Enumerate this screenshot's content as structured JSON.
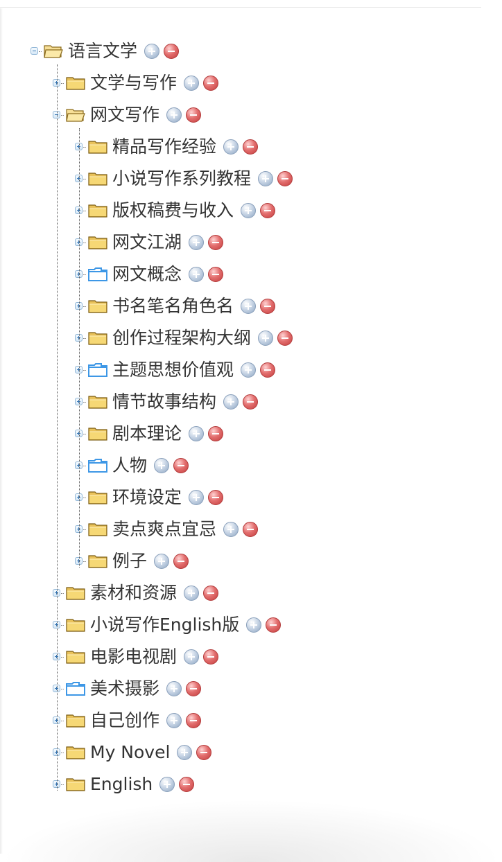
{
  "tree": {
    "root": {
      "label": "语言文学",
      "expanded": true,
      "folder_style": "open-yellow",
      "children": [
        {
          "label": "文学与写作",
          "expanded": false,
          "folder_style": "closed-yellow"
        },
        {
          "label": "网文写作",
          "expanded": true,
          "folder_style": "open-yellow",
          "children": [
            {
              "label": "精品写作经验",
              "folder_style": "closed-yellow"
            },
            {
              "label": "小说写作系列教程",
              "folder_style": "closed-yellow"
            },
            {
              "label": "版权稿费与收入",
              "folder_style": "closed-yellow"
            },
            {
              "label": "网文江湖",
              "folder_style": "closed-yellow"
            },
            {
              "label": "网文概念",
              "folder_style": "blue-outline"
            },
            {
              "label": "书名笔名角色名",
              "folder_style": "closed-yellow"
            },
            {
              "label": "创作过程架构大纲",
              "folder_style": "closed-yellow"
            },
            {
              "label": "主题思想价值观",
              "folder_style": "blue-outline"
            },
            {
              "label": "情节故事结构",
              "folder_style": "closed-yellow"
            },
            {
              "label": "剧本理论",
              "folder_style": "closed-yellow"
            },
            {
              "label": "人物",
              "folder_style": "blue-outline"
            },
            {
              "label": "环境设定",
              "folder_style": "closed-yellow"
            },
            {
              "label": "卖点爽点宜忌",
              "folder_style": "closed-yellow"
            },
            {
              "label": "例子",
              "folder_style": "closed-yellow"
            }
          ]
        },
        {
          "label": "素材和资源",
          "expanded": false,
          "folder_style": "closed-yellow"
        },
        {
          "label": "小说写作English版",
          "expanded": false,
          "folder_style": "closed-yellow"
        },
        {
          "label": "电影电视剧",
          "expanded": false,
          "folder_style": "closed-yellow"
        },
        {
          "label": "美术摄影",
          "expanded": false,
          "folder_style": "blue-outline"
        },
        {
          "label": "自己创作",
          "expanded": false,
          "folder_style": "closed-yellow"
        },
        {
          "label": "My Novel",
          "expanded": false,
          "folder_style": "closed-yellow"
        },
        {
          "label": "English",
          "expanded": false,
          "folder_style": "closed-yellow"
        }
      ]
    },
    "icons": {
      "add": "add-circle-icon",
      "remove": "remove-circle-icon",
      "expand": "plus-square-icon",
      "collapse": "minus-square-icon"
    },
    "colors": {
      "folder_yellow": "#f3d06b",
      "folder_blue": "#3d97e6",
      "add_button": "#a8bbd3",
      "remove_button": "#d95757",
      "text": "#333333"
    }
  }
}
